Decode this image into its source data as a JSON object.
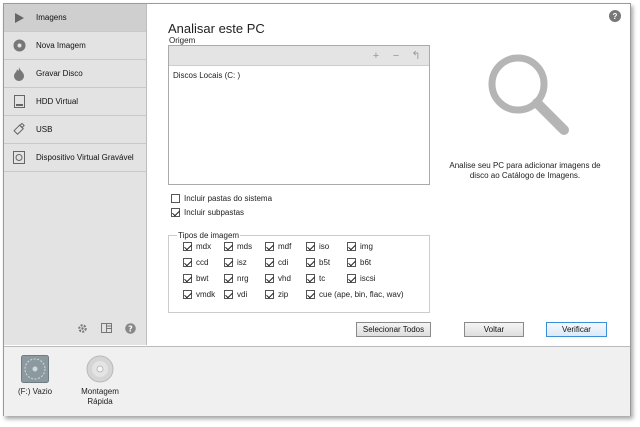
{
  "sidebar": {
    "items": [
      {
        "label": "Imagens",
        "icon": "play-icon"
      },
      {
        "label": "Nova Imagem",
        "icon": "disc-icon"
      },
      {
        "label": "Gravar Disco",
        "icon": "flame-icon"
      },
      {
        "label": "HDD Virtual",
        "icon": "hdd-icon"
      },
      {
        "label": "USB",
        "icon": "usb-icon"
      },
      {
        "label": "Dispositivo Virtual Gravável",
        "icon": "virtual-device-icon"
      }
    ],
    "footer_icons": [
      "gear-icon",
      "layout-icon",
      "help-icon"
    ]
  },
  "main": {
    "title": "Analisar este PC",
    "help": "?",
    "origin_label": "Origem",
    "origin_items": [
      "Discos Locais (C: )"
    ],
    "toolbar": {
      "add": "+",
      "remove": "−",
      "back": "↰"
    },
    "include_system": "Incluir pastas do sistema",
    "include_subfolders": "Incluir subpastas",
    "types_label": "Tipos de imagem",
    "types": [
      "mdx",
      "mds",
      "mdf",
      "iso",
      "img",
      "ccd",
      "isz",
      "cdi",
      "b5t",
      "b6t",
      "bwt",
      "nrg",
      "vhd",
      "tc",
      "iscsi",
      "vmdk",
      "vdi",
      "zip",
      "cue (ape, bin, flac, wav)"
    ],
    "select_all": "Selecionar Todos",
    "back_button": "Voltar",
    "verify_button": "Verificar",
    "info": "Analise seu PC para adicionar imagens de disco ao Catálogo de Imagens."
  },
  "bottom": {
    "drives": [
      "(F:) Vazio",
      "Montagem Rápida"
    ]
  },
  "colors": {
    "sidebar_bg": "#e3e3e3",
    "accent": "#3b8fd9"
  }
}
